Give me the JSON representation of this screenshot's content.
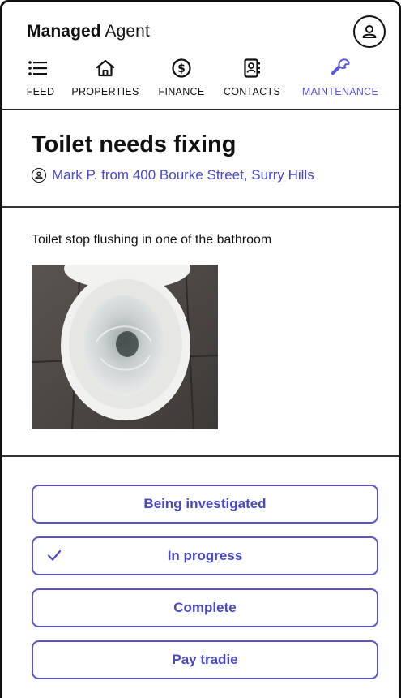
{
  "header": {
    "brand_bold": "Managed",
    "brand_regular": "Agent",
    "profile_icon": "person-icon"
  },
  "nav": [
    {
      "label": "FEED",
      "icon": "list-icon",
      "active": false
    },
    {
      "label": "PROPERTIES",
      "icon": "house-icon",
      "active": false
    },
    {
      "label": "FINANCE",
      "icon": "dollar-icon",
      "active": false
    },
    {
      "label": "CONTACTS",
      "icon": "contacts-book-icon",
      "active": false
    },
    {
      "label": "MAINTENANCE",
      "icon": "wrench-icon",
      "active": true
    }
  ],
  "request": {
    "title": "Toilet needs fixing",
    "reporter": "Mark P. from 400 Bourke Street, Surry Hills",
    "description": "Toilet stop flushing in one of the bathroom"
  },
  "status_options": [
    {
      "label": "Being investigated",
      "selected": false
    },
    {
      "label": "In progress",
      "selected": true
    },
    {
      "label": "Complete",
      "selected": false
    },
    {
      "label": "Pay tradie",
      "selected": false
    }
  ],
  "colors": {
    "accent": "#5753cf",
    "link": "#4a48c9",
    "active_nav": "#5a57d9"
  }
}
